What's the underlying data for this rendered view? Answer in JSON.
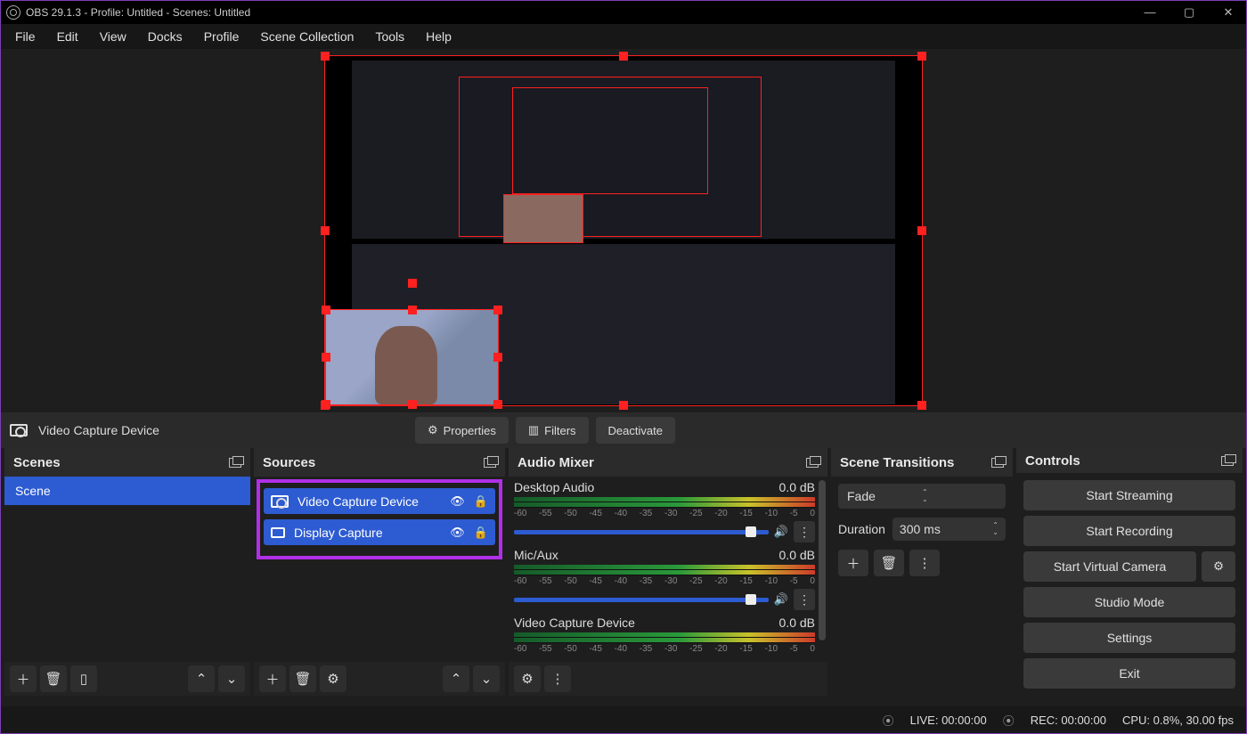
{
  "title": "OBS 29.1.3 - Profile: Untitled - Scenes: Untitled",
  "menubar": [
    "File",
    "Edit",
    "View",
    "Docks",
    "Profile",
    "Scene Collection",
    "Tools",
    "Help"
  ],
  "source_toolbar": {
    "current_source": "Video Capture Device",
    "properties_btn": "Properties",
    "filters_btn": "Filters",
    "deactivate_btn": "Deactivate"
  },
  "panels": {
    "scenes": {
      "title": "Scenes",
      "items": [
        "Scene"
      ]
    },
    "sources": {
      "title": "Sources",
      "items": [
        {
          "name": "Video Capture Device",
          "visible": true,
          "locked": false
        },
        {
          "name": "Display Capture",
          "visible": true,
          "locked": false
        }
      ]
    },
    "mixer": {
      "title": "Audio Mixer",
      "ticks": [
        "-60",
        "-55",
        "-50",
        "-45",
        "-40",
        "-35",
        "-30",
        "-25",
        "-20",
        "-15",
        "-10",
        "-5",
        "0"
      ],
      "channels": [
        {
          "name": "Desktop Audio",
          "level": "0.0 dB"
        },
        {
          "name": "Mic/Aux",
          "level": "0.0 dB"
        },
        {
          "name": "Video Capture Device",
          "level": "0.0 dB"
        }
      ]
    },
    "transitions": {
      "title": "Scene Transitions",
      "selected": "Fade",
      "duration_label": "Duration",
      "duration_value": "300 ms"
    },
    "controls": {
      "title": "Controls",
      "buttons": {
        "start_streaming": "Start Streaming",
        "start_recording": "Start Recording",
        "start_virtual_camera": "Start Virtual Camera",
        "studio_mode": "Studio Mode",
        "settings": "Settings",
        "exit": "Exit"
      }
    }
  },
  "statusbar": {
    "live": "LIVE: 00:00:00",
    "rec": "REC: 00:00:00",
    "cpu": "CPU: 0.8%, 30.00 fps"
  }
}
